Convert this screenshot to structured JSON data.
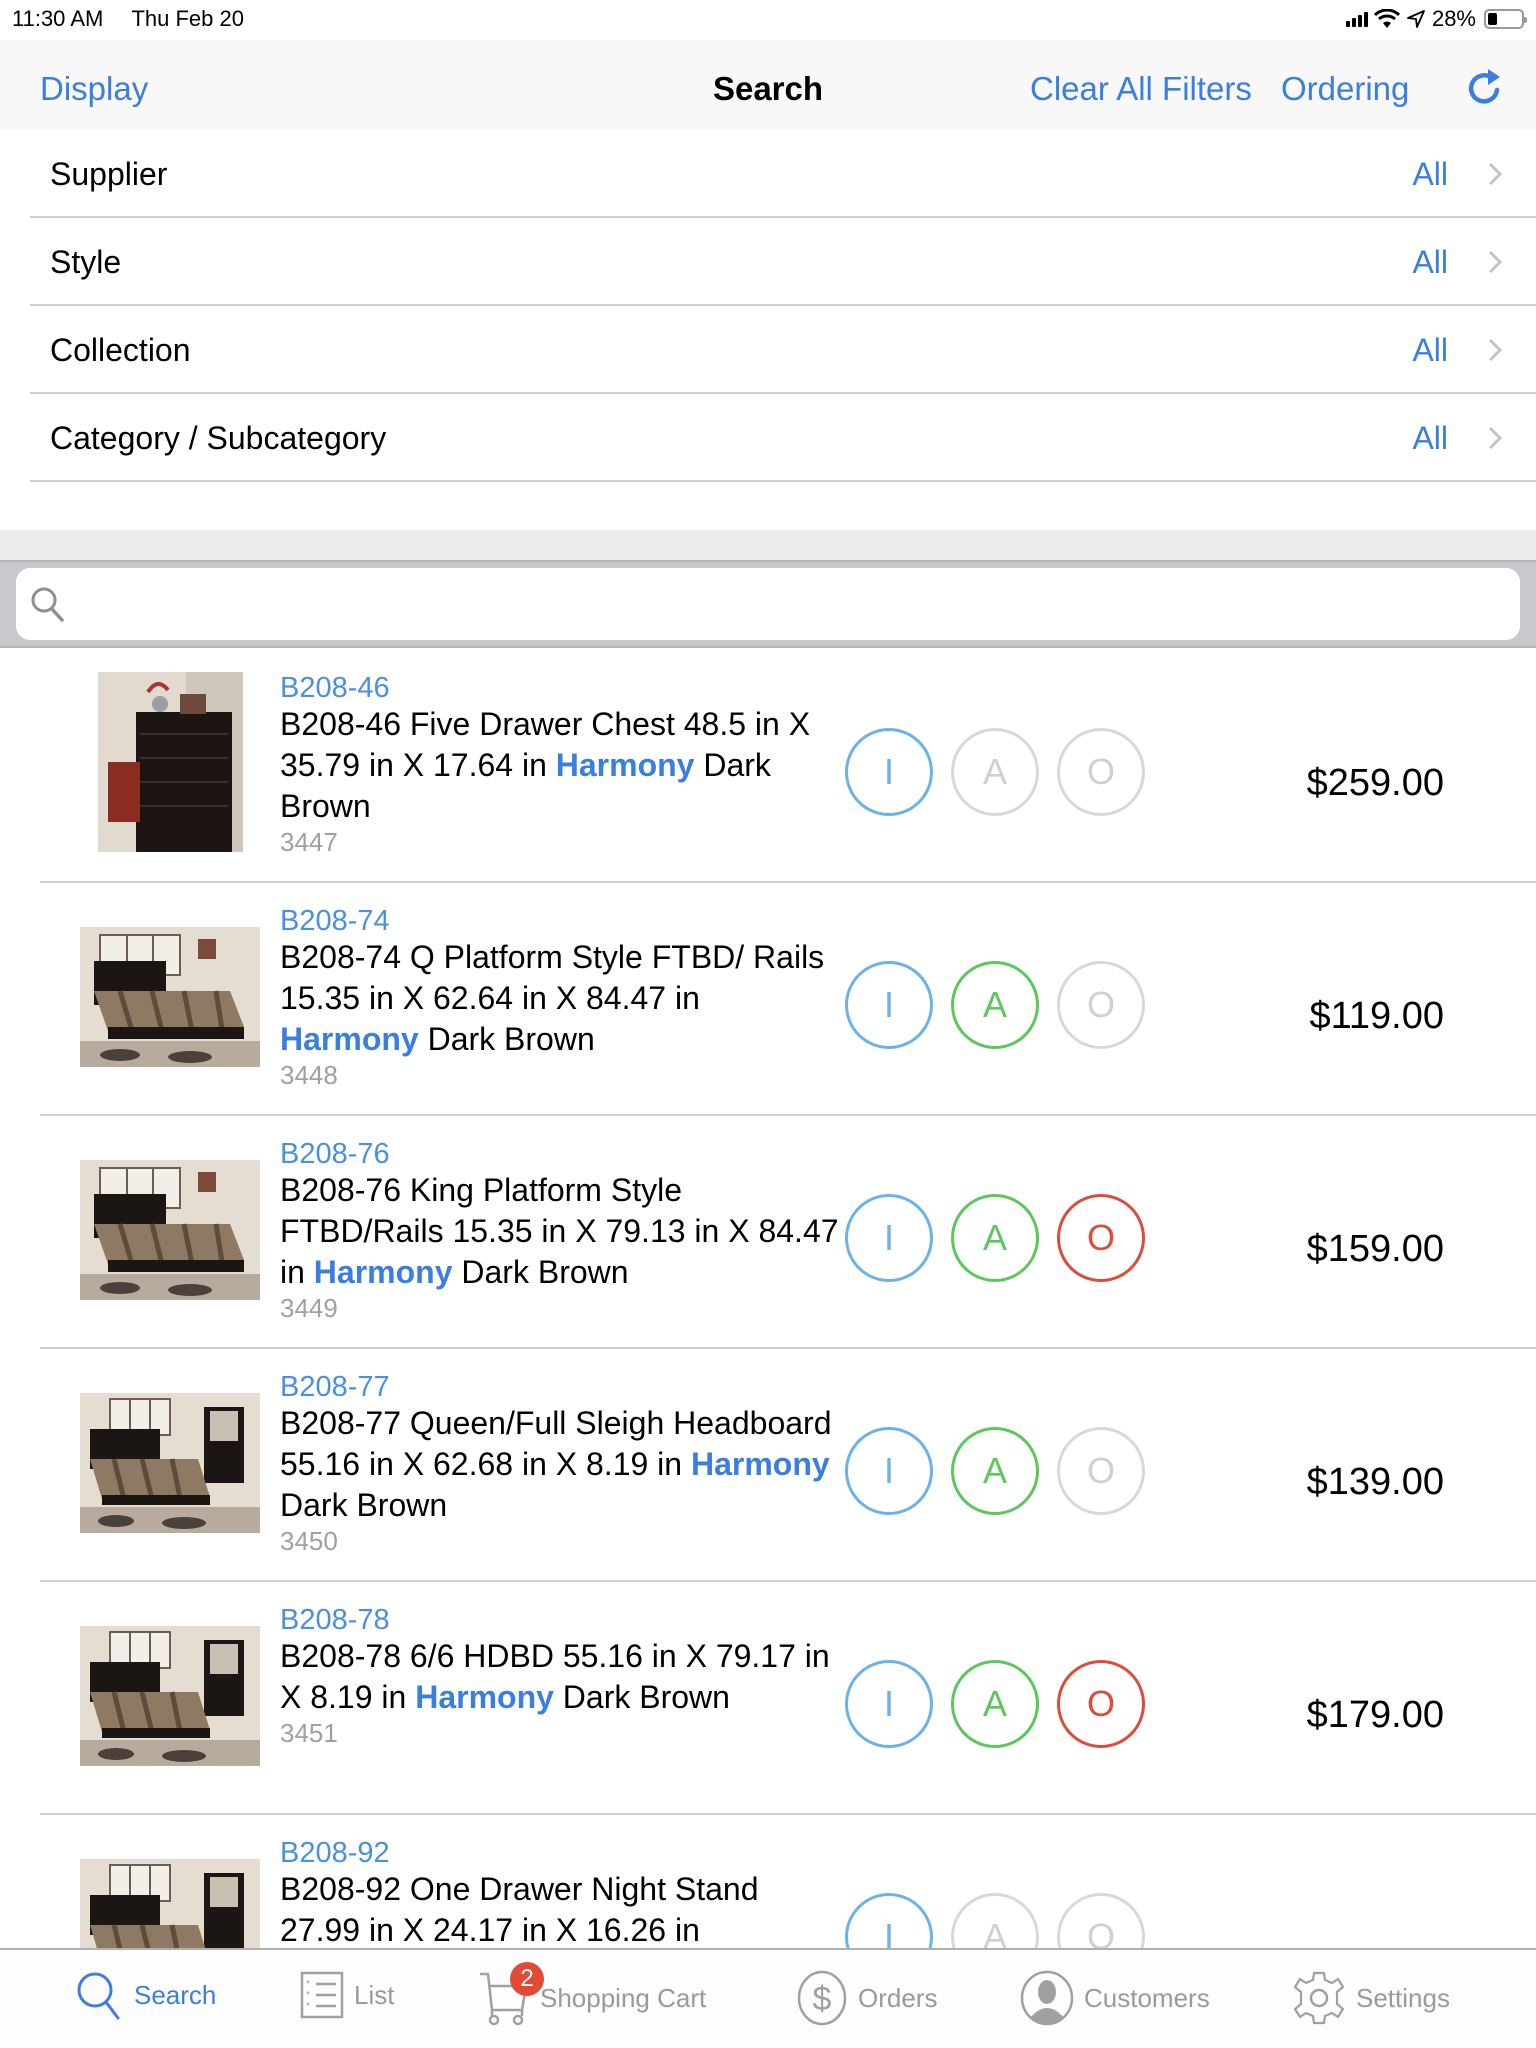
{
  "status_bar": {
    "time": "11:30 AM",
    "date": "Thu Feb 20",
    "battery_percent_label": "28%",
    "battery_level": 0.28
  },
  "nav": {
    "display_label": "Display",
    "title": "Search",
    "clear_filters_label": "Clear All Filters",
    "ordering_label": "Ordering",
    "refresh_icon": "refresh-icon"
  },
  "filters": [
    {
      "label": "Supplier",
      "value": "All"
    },
    {
      "label": "Style",
      "value": "All"
    },
    {
      "label": "Collection",
      "value": "All"
    },
    {
      "label": "Category / Subcategory",
      "value": "All"
    }
  ],
  "search": {
    "value": "",
    "placeholder": ""
  },
  "colors": {
    "accent": "#3a7ee0",
    "i_active": "#6ab2ea",
    "a_active": "#5cc75c",
    "o_active": "#dd4b39",
    "inactive": "#d8d8d8",
    "badge": "#e04a36"
  },
  "products": [
    {
      "sku": "B208-46",
      "desc_before": "B208-46 Five Drawer Chest 48.5 in X 35.79 in X 17.64 in ",
      "collection": "Harmony",
      "desc_after": " Dark Brown",
      "number": "3447",
      "price": "$259.00",
      "image": "chest",
      "i": true,
      "a": false,
      "o": false
    },
    {
      "sku": "B208-74",
      "desc_before": "B208-74 Q Platform Style FTBD/ Rails 15.35 in X 62.64 in X 84.47 in ",
      "collection": "Harmony",
      "desc_after": " Dark Brown",
      "number": "3448",
      "price": "$119.00",
      "image": "bed",
      "i": true,
      "a": true,
      "o": false
    },
    {
      "sku": "B208-76",
      "desc_before": "B208-76 King Platform Style FTBD/Rails 15.35 in X 79.13 in X 84.47 in ",
      "collection": "Harmony",
      "desc_after": " Dark Brown",
      "number": "3449",
      "price": "$159.00",
      "image": "bed",
      "i": true,
      "a": true,
      "o": true
    },
    {
      "sku": "B208-77",
      "desc_before": "B208-77 Queen/Full Sleigh Headboard 55.16 in X 62.68 in X 8.19 in ",
      "collection": "Harmony",
      "desc_after": " Dark Brown",
      "number": "3450",
      "price": "$139.00",
      "image": "bedroom",
      "i": true,
      "a": true,
      "o": false
    },
    {
      "sku": "B208-78",
      "desc_before": "B208-78 6/6 HDBD 55.16 in X 79.17 in X 8.19 in ",
      "collection": "Harmony",
      "desc_after": " Dark Brown",
      "number": "3451",
      "price": "$179.00",
      "image": "bedroom",
      "i": true,
      "a": true,
      "o": true
    },
    {
      "sku": "B208-92",
      "desc_before": "B208-92 One Drawer Night Stand 27.99 in X 24.17 in X 16.26 in",
      "collection": "",
      "desc_after": "",
      "number": "",
      "price": "",
      "image": "bedroom",
      "i": true,
      "a": false,
      "o": false
    }
  ],
  "iao_labels": {
    "i": "I",
    "a": "A",
    "o": "O"
  },
  "tabs": [
    {
      "label": "Search",
      "icon": "search-icon",
      "active": true
    },
    {
      "label": "List",
      "icon": "list-icon",
      "active": false
    },
    {
      "label": "Shopping Cart",
      "icon": "shopping-cart-icon",
      "active": false,
      "badge": "2"
    },
    {
      "label": "Orders",
      "icon": "dollar-icon",
      "active": false
    },
    {
      "label": "Customers",
      "icon": "customer-icon",
      "active": false
    },
    {
      "label": "Settings",
      "icon": "gear-icon",
      "active": false
    }
  ]
}
